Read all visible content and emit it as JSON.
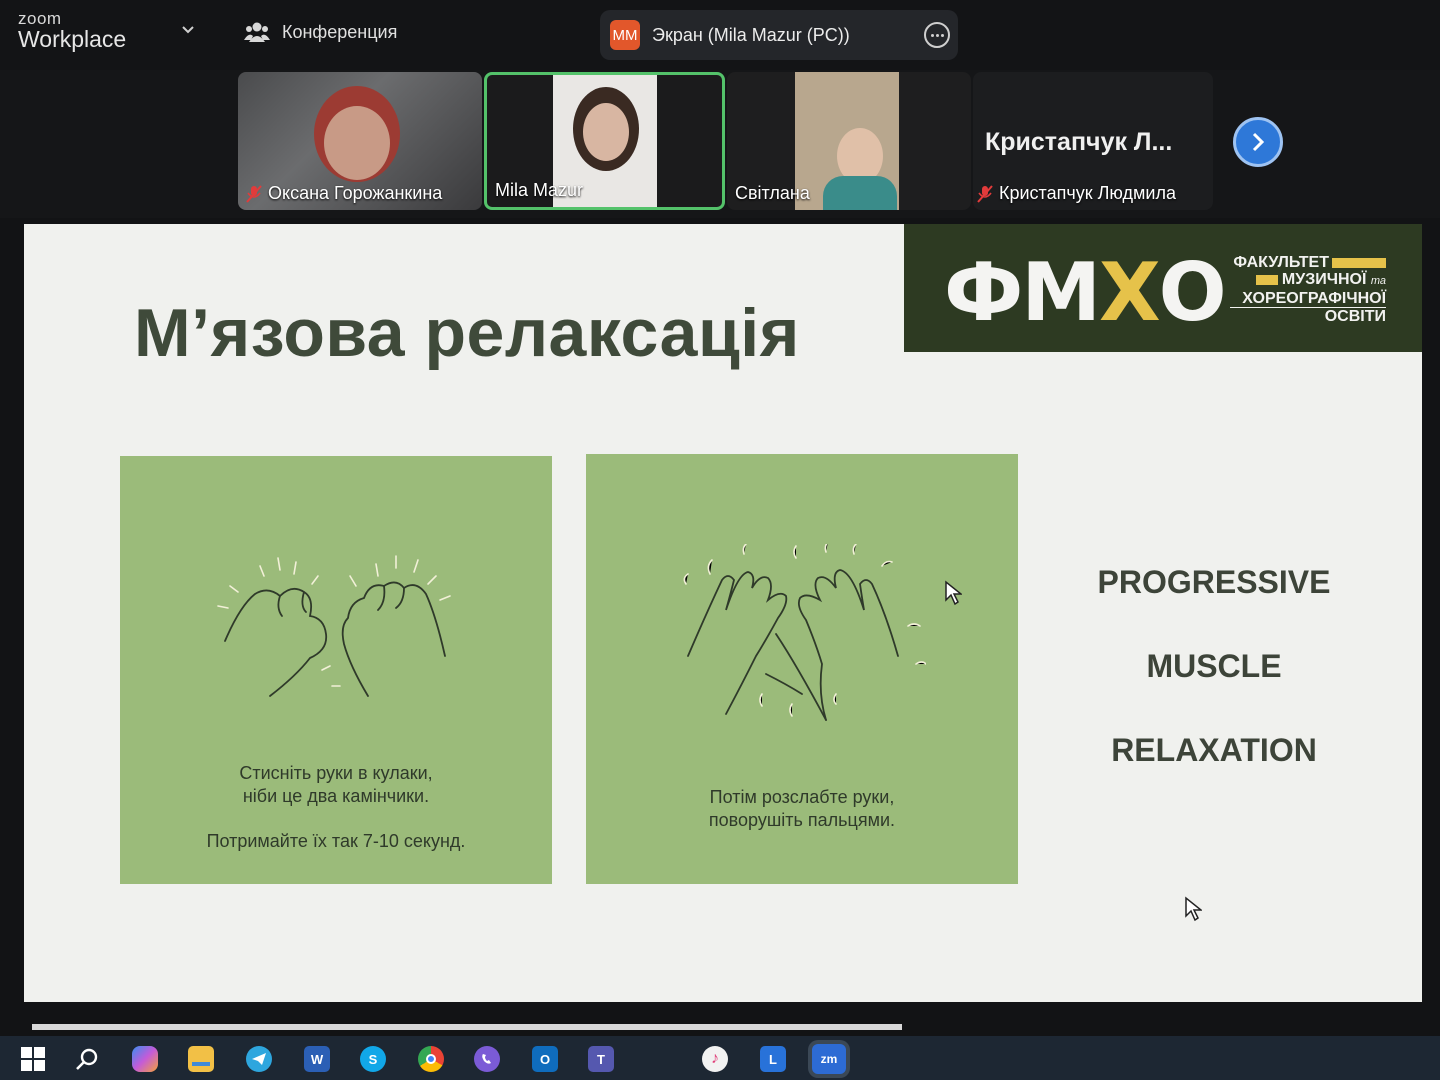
{
  "app": {
    "brand_small": "zoom",
    "brand_large": "Workplace",
    "meeting_label": "Конференция",
    "share_badge": "ММ",
    "share_label": "Экран (Mila Mazur (PC))"
  },
  "participants": [
    {
      "name": "Оксана Горожанкина",
      "muted": true
    },
    {
      "name": "Mila Mazur",
      "muted": false,
      "active_speaker": true
    },
    {
      "name": "Світлана",
      "muted": false
    },
    {
      "big_name": "Кристапчук  Л...",
      "name": "Кристапчук Людмила",
      "muted": true
    }
  ],
  "slide": {
    "title": "М’язова релаксація",
    "logo_letters_1": "ФМ",
    "logo_letters_y": "Х",
    "logo_letters_2": "О",
    "logo_line1": "ФАКУЛЬТЕТ",
    "logo_line2": "МУЗИЧНОЇ",
    "logo_line2_small": "та",
    "logo_line3": "ХОРЕОГРАФІЧНОЇ",
    "logo_line4": "ОСВІТИ",
    "card1_line1": "Стисніть руки в кулаки,",
    "card1_line2": "ніби це два камінчики.",
    "card1_line3": "Потримайте їх так 7-10 секунд.",
    "card2_line1": "Потім розслабте руки,",
    "card2_line2": "поворушіть пальцями.",
    "word1": "PROGRESSIVE",
    "word2": "MUSCLE",
    "word3": "RELAXATION"
  },
  "colors": {
    "card_green": "#9bbb7a",
    "logo_bg": "#2d3a22",
    "logo_accent": "#e6c24a",
    "active_border": "#54c26a",
    "share_badge": "#e2572b"
  },
  "taskbar_icons": [
    "windows-icon",
    "search-icon",
    "copilot-icon",
    "file-explorer-icon",
    "telegram-icon",
    "word-icon",
    "skype-icon",
    "chrome-icon",
    "viber-icon",
    "outlook-icon",
    "teams-icon",
    "itunes-icon",
    "l-app-icon",
    "zoom-icon"
  ],
  "taskbar_labels": {
    "word": "W",
    "skype": "S",
    "outlook": "O",
    "teams": "T",
    "l_app": "L",
    "zoom": "zm"
  }
}
